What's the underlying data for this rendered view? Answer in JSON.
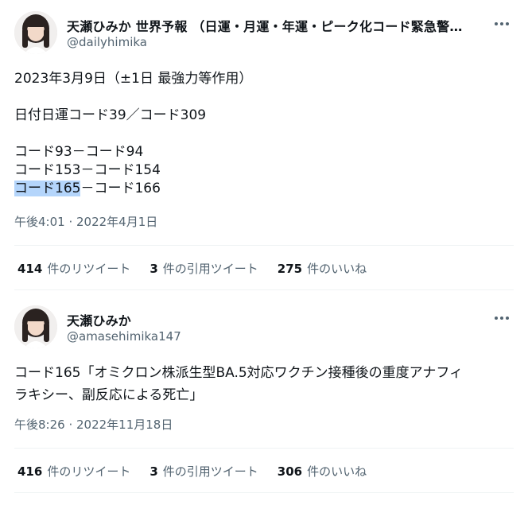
{
  "tweets": [
    {
      "display_name": "天瀬ひみか 世界予報 （日運・月運・年運・ピーク化コード緊急警…",
      "handle": "@dailyhimika",
      "body": {
        "line1": "2023年3月9日（±1日 最強力等作用）",
        "line2": "日付日運コード39／コード309",
        "line3": "コード93－コード94",
        "line4": "コード153－コード154",
        "line5_highlight": "コード165",
        "line5_rest": "－コード166"
      },
      "timestamp": "午後4:01 · 2022年4月1日",
      "stats": {
        "retweets_num": "414",
        "retweets_label": "件のリツイート",
        "quotes_num": "3",
        "quotes_label": "件の引用ツイート",
        "likes_num": "275",
        "likes_label": "件のいいね"
      }
    },
    {
      "display_name": "天瀬ひみか",
      "handle": "@amasehimika147",
      "body": {
        "line1": "コード165「オミクロン株派生型BA.5対応ワクチン接種後の重度アナフィ",
        "line2": "ラキシー、副反応による死亡」"
      },
      "timestamp": "午後8:26 · 2022年11月18日",
      "stats": {
        "retweets_num": "416",
        "retweets_label": "件のリツイート",
        "quotes_num": "3",
        "quotes_label": "件の引用ツイート",
        "likes_num": "306",
        "likes_label": "件のいいね"
      }
    }
  ],
  "icons": {
    "more": "more-horizontal-icon",
    "avatar": "profile-photo"
  },
  "colors": {
    "text": "#0f1419",
    "secondary": "#536471",
    "highlight": "#b4d5fb",
    "divider": "#eff3f4"
  }
}
